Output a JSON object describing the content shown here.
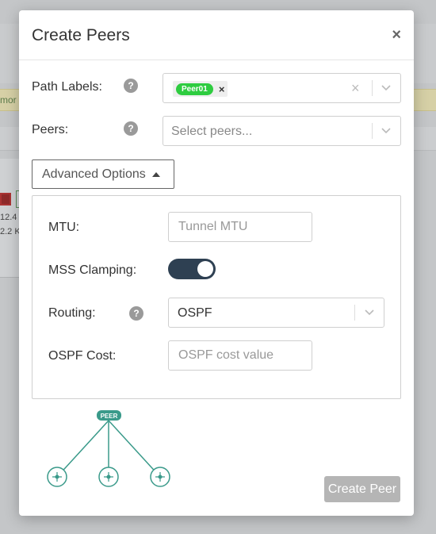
{
  "background": {
    "banner_text": "mor",
    "numbers": [
      "12.4",
      "2.2 K"
    ]
  },
  "modal": {
    "title": "Create Peers",
    "close_glyph": "×"
  },
  "path_labels": {
    "label": "Path Labels:",
    "help": "?",
    "tag": "Peer01",
    "tag_remove": "×",
    "clear": "×"
  },
  "peers": {
    "label": "Peers:",
    "help": "?",
    "placeholder": "Select peers..."
  },
  "advanced": {
    "button_label": "Advanced Options",
    "mtu_label": "MTU:",
    "mtu_placeholder": "Tunnel MTU",
    "mss_label": "MSS Clamping:",
    "mss_on": true,
    "routing_label": "Routing:",
    "routing_help": "?",
    "routing_value": "OSPF",
    "ospf_cost_label": "OSPF Cost:",
    "ospf_cost_placeholder": "OSPF cost value"
  },
  "diagram": {
    "hub_label": "PEER"
  },
  "footer": {
    "create_label": "Create Peer"
  },
  "colors": {
    "tag_green": "#2ecc40",
    "toggle_on": "#2e4052",
    "diagram_teal": "#3a9a8a",
    "button_disabled": "#b5b5b5"
  }
}
